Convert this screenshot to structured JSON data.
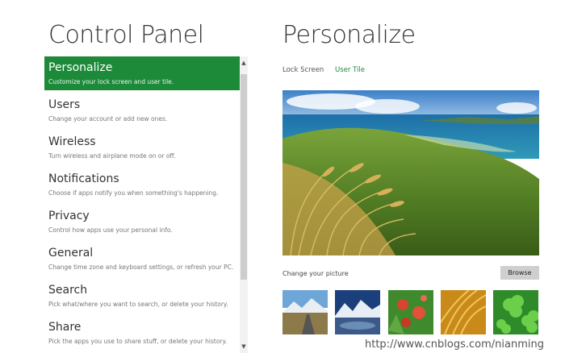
{
  "page": {
    "left_title": "Control Panel",
    "right_title": "Personalize"
  },
  "sidebar": {
    "items": [
      {
        "label": "Personalize",
        "description": "Customize your lock screen and user tile.",
        "selected": true
      },
      {
        "label": "Users",
        "description": "Change your account or add new ones."
      },
      {
        "label": "Wireless",
        "description": "Turn wireless and airplane mode on or off."
      },
      {
        "label": "Notifications",
        "description": "Choose if apps notify you when something's happening."
      },
      {
        "label": "Privacy",
        "description": "Control how apps use your personal info."
      },
      {
        "label": "General",
        "description": "Change time zone and keyboard settings, or refresh your PC."
      },
      {
        "label": "Search",
        "description": "Pick what/where you want to search, or delete your history."
      },
      {
        "label": "Share",
        "description": "Pick the apps you use to share stuff, or delete your history."
      }
    ]
  },
  "tabs": [
    {
      "label": "Lock Screen",
      "active": false
    },
    {
      "label": "User Tile",
      "active": true
    }
  ],
  "personalize": {
    "change_picture_label": "Change your picture",
    "browse_label": "Browse",
    "thumbnails": [
      "mountain-road-thumbnail",
      "snowy-mountains-thumbnail",
      "red-flowers-thumbnail",
      "golden-grass-thumbnail",
      "clover-leaves-thumbnail"
    ]
  },
  "watermark": "http://www.cnblogs.com/nianming",
  "colors": {
    "accent": "#1d8a3a",
    "selected_bg": "#1d8a3a",
    "button_bg": "#cfcfcf"
  }
}
